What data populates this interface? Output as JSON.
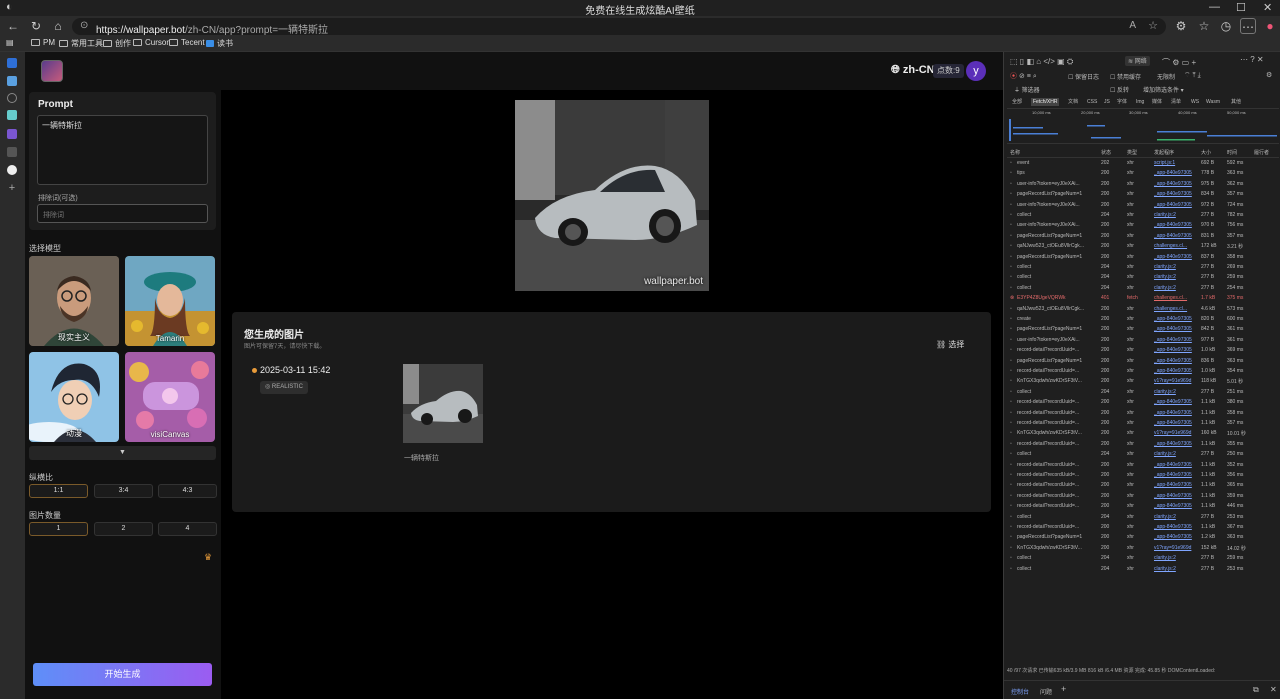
{
  "browser": {
    "window_title": "免费在线生成炫酷AI壁纸",
    "url_host": "https://wallpaper.bot",
    "url_path": "/zh-CN/app?prompt=一辆特斯拉",
    "bookmarks": [
      "PM",
      "常用工具",
      "创作",
      "Cursor",
      "Tecent",
      "读书"
    ]
  },
  "header": {
    "language": "zh-CN",
    "points": "点数:9",
    "avatar_letter": "y"
  },
  "left_panel": {
    "prompt_label": "Prompt",
    "prompt_value": "一辆特斯拉",
    "negative_label": "排除词(可选)",
    "negative_placeholder": "排除词",
    "model_label": "选择模型",
    "models": [
      {
        "name": "现实主义"
      },
      {
        "name": "Tamarin"
      },
      {
        "name": "动漫"
      },
      {
        "name": "visiCanvas"
      }
    ],
    "ratio_label": "纵横比",
    "ratios": [
      "1:1",
      "3:4",
      "4:3"
    ],
    "count_label": "图片数量",
    "counts": [
      "1",
      "2",
      "4"
    ],
    "generate_label": "开始生成"
  },
  "main": {
    "watermark": "wallpaper.bot",
    "generated_title": "您生成的图片",
    "generated_subtitle": "图片可保留7天，请尽快下载。",
    "select_label": "选择",
    "date": "2025-03-11 15:42",
    "style_tag": "REALISTIC",
    "thumb_caption": "一辆特斯拉"
  },
  "devtools": {
    "network_tab": "网络",
    "preserve_log": "保留日志",
    "disable_cache": "禁用缓存",
    "throttle": "无限制",
    "filter_placeholder": "筛选器",
    "invert": "反转",
    "more_filters": "增加筛选条件",
    "type_tabs": [
      "全部",
      "Fetch/XHR",
      "文档",
      "CSS",
      "JS",
      "字体",
      "Img",
      "媒体",
      "清单",
      "WS",
      "Wasm",
      "其他"
    ],
    "timeline_ticks": [
      "10,000 ms",
      "20,000 ms",
      "30,000 ms",
      "40,000 ms",
      "50,000 ms"
    ],
    "columns": [
      "名称",
      "状态",
      "类型",
      "发起程序",
      "大小",
      "时间",
      "履行者"
    ],
    "rows": [
      [
        "event",
        "202",
        "xhr",
        "script.js:1",
        "692 B",
        "592 ms"
      ],
      [
        "tips",
        "200",
        "xhr",
        "_app-840e97305",
        "778 B",
        "363 ms"
      ],
      [
        "user-info?token=eyJ0eXAi...",
        "200",
        "xhr",
        "_app-840e97305",
        "975 B",
        "362 ms"
      ],
      [
        "pageRecordList?pageNum=1",
        "200",
        "xhr",
        "_app-840e97305",
        "834 B",
        "357 ms"
      ],
      [
        "user-info?token=eyJ0eXAi...",
        "200",
        "xhr",
        "_app-840e97305",
        "972 B",
        "724 ms"
      ],
      [
        "collect",
        "204",
        "xhr",
        "clarity.js:2",
        "277 B",
        "782 ms"
      ],
      [
        "user-info?token=eyJ0eXAi...",
        "200",
        "xhr",
        "_app-840e97305",
        "970 B",
        "756 ms"
      ],
      [
        "pageRecordList?pageNum=1",
        "200",
        "xhr",
        "_app-840e97305",
        "831 B",
        "357 ms"
      ],
      [
        "qaNJww523_ctOEu8VllrCgk...",
        "200",
        "xhr",
        "challenges.cl...",
        "172 kB",
        "3.21 秒"
      ],
      [
        "pageRecordList?pageNum=1",
        "200",
        "xhr",
        "_app-840e97305",
        "837 B",
        "358 ms"
      ],
      [
        "collect",
        "204",
        "xhr",
        "clarity.js:2",
        "277 B",
        "269 ms"
      ],
      [
        "collect",
        "204",
        "xhr",
        "clarity.js:2",
        "277 B",
        "259 ms"
      ],
      [
        "collect",
        "204",
        "xhr",
        "clarity.js:2",
        "277 B",
        "254 ms"
      ],
      [
        "E3YP4Z8UgeVQRWk",
        "401",
        "fetch",
        "challenges.cl...",
        "1.7 kB",
        "375 ms"
      ],
      [
        "qaNJww523_ctOEu8VllrCgk...",
        "200",
        "xhr",
        "challenges.cl...",
        "4.6 kB",
        "573 ms"
      ],
      [
        "create",
        "200",
        "xhr",
        "_app-840e97305",
        "820 B",
        "600 ms"
      ],
      [
        "pageRecordList?pageNum=1",
        "200",
        "xhr",
        "_app-840e97305",
        "842 B",
        "361 ms"
      ],
      [
        "user-info?token=eyJ0eXAi...",
        "200",
        "xhr",
        "_app-840e97305",
        "977 B",
        "361 ms"
      ],
      [
        "record-detail?recordUuid=...",
        "200",
        "xhr",
        "_app-840e97305",
        "1.0 kB",
        "369 ms"
      ],
      [
        "pageRecordList?pageNum=1",
        "200",
        "xhr",
        "_app-840e97305",
        "836 B",
        "363 ms"
      ],
      [
        "record-detail?recordUuid=...",
        "200",
        "xhr",
        "_app-840e97305",
        "1.0 kB",
        "354 ms"
      ],
      [
        "KnTGX3qdwh/zwKDrSF3tV...",
        "200",
        "xhr",
        "v1?ray=91e969d",
        "118 kB",
        "5.01 秒"
      ],
      [
        "collect",
        "204",
        "xhr",
        "clarity.js:2",
        "277 B",
        "251 ms"
      ],
      [
        "record-detail?recordUuid=...",
        "200",
        "xhr",
        "_app-840e97305",
        "1.1 kB",
        "380 ms"
      ],
      [
        "record-detail?recordUuid=...",
        "200",
        "xhr",
        "_app-840e97305",
        "1.1 kB",
        "358 ms"
      ],
      [
        "record-detail?recordUuid=...",
        "200",
        "xhr",
        "_app-840e97305",
        "1.1 kB",
        "357 ms"
      ],
      [
        "KnTGX3qdwh/zwKDrSF3tV...",
        "200",
        "xhr",
        "v1?ray=91e969d",
        "160 kB",
        "10.01 秒"
      ],
      [
        "record-detail?recordUuid=...",
        "200",
        "xhr",
        "_app-840e97305",
        "1.1 kB",
        "355 ms"
      ],
      [
        "collect",
        "204",
        "xhr",
        "clarity.js:2",
        "277 B",
        "250 ms"
      ],
      [
        "record-detail?recordUuid=...",
        "200",
        "xhr",
        "_app-840e97305",
        "1.1 kB",
        "352 ms"
      ],
      [
        "record-detail?recordUuid=...",
        "200",
        "xhr",
        "_app-840e97305",
        "1.1 kB",
        "356 ms"
      ],
      [
        "record-detail?recordUuid=...",
        "200",
        "xhr",
        "_app-840e97305",
        "1.1 kB",
        "365 ms"
      ],
      [
        "record-detail?recordUuid=...",
        "200",
        "xhr",
        "_app-840e97305",
        "1.1 kB",
        "359 ms"
      ],
      [
        "record-detail?recordUuid=...",
        "200",
        "xhr",
        "_app-840e97305",
        "1.1 kB",
        "446 ms"
      ],
      [
        "collect",
        "204",
        "xhr",
        "clarity.js:2",
        "277 B",
        "253 ms"
      ],
      [
        "record-detail?recordUuid=...",
        "200",
        "xhr",
        "_app-840e97305",
        "1.1 kB",
        "367 ms"
      ],
      [
        "pageRecordList?pageNum=1",
        "200",
        "xhr",
        "_app-840e97305",
        "1.2 kB",
        "363 ms"
      ],
      [
        "KnTGX3qdwh/zwKDrSF3tV...",
        "200",
        "xhr",
        "v1?ray=91e969d",
        "152 kB",
        "14.02 秒"
      ],
      [
        "collect",
        "204",
        "xhr",
        "clarity.js:2",
        "277 B",
        "259 ms"
      ],
      [
        "collect",
        "204",
        "xhr",
        "clarity.js:2",
        "277 B",
        "253 ms"
      ]
    ],
    "status_bar": "40 /97 次请求   已传输635 kB/3.9 MB   816 kB /6.4 MB 资源   完成: 45.85 秒   DOMContentLoaded:",
    "bottom_tabs": [
      "控制台",
      "问题"
    ]
  }
}
